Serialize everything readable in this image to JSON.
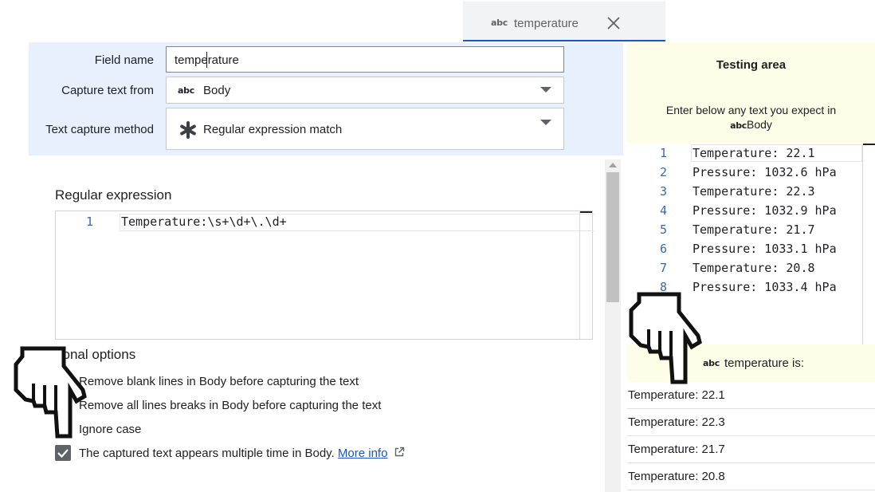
{
  "tab": {
    "icon": "abc-text-icon",
    "icon_text": "abc",
    "label": "temperature",
    "close_icon": "close-icon"
  },
  "settings": {
    "field_name_label": "Field name",
    "field_name_value": "temperature",
    "capture_from_label": "Capture text from",
    "capture_from_icon_text": "abc",
    "capture_from_value": "Body",
    "method_label": "Text capture method",
    "method_icon": "asterisk-icon",
    "method_value": "Regular expression match"
  },
  "regex": {
    "title": "Regular expression",
    "lines": [
      {
        "num": "1",
        "text": "Temperature:\\s+\\d+\\.\\d+"
      }
    ]
  },
  "additional": {
    "title": "Additional options",
    "options": [
      {
        "label": "Remove blank lines in Body before capturing the text",
        "checked": false
      },
      {
        "label": "Remove all lines breaks in Body before capturing the text",
        "checked": false
      },
      {
        "label": "Ignore case",
        "checked": false
      },
      {
        "label": "The captured text appears multiple time in Body.",
        "checked": true
      }
    ],
    "more_info": "More info",
    "external_link_icon": "external-link-icon"
  },
  "testing": {
    "title": "Testing area",
    "desc_line1": "Enter below any text you expect in",
    "desc_icon_text": "abc",
    "desc_line2": "Body",
    "lines": [
      {
        "num": "1",
        "text": "Temperature: 22.1"
      },
      {
        "num": "2",
        "text": "Pressure: 1032.6 hPa"
      },
      {
        "num": "3",
        "text": "Temperature: 22.3"
      },
      {
        "num": "4",
        "text": "Pressure: 1032.9 hPa"
      },
      {
        "num": "5",
        "text": "Temperature: 21.7"
      },
      {
        "num": "6",
        "text": "Pressure: 1033.1 hPa"
      },
      {
        "num": "7",
        "text": "Temperature: 20.8"
      },
      {
        "num": "8",
        "text": "Pressure: 1033.4 hPa"
      }
    ],
    "result_icon_text": "abc",
    "result_label": "temperature is:",
    "results": [
      "Temperature: 22.1",
      "Temperature: 22.3",
      "Temperature: 21.7",
      "Temperature: 20.8"
    ]
  },
  "overlay": {
    "pointer_icon": "pointing-hand-icon"
  }
}
